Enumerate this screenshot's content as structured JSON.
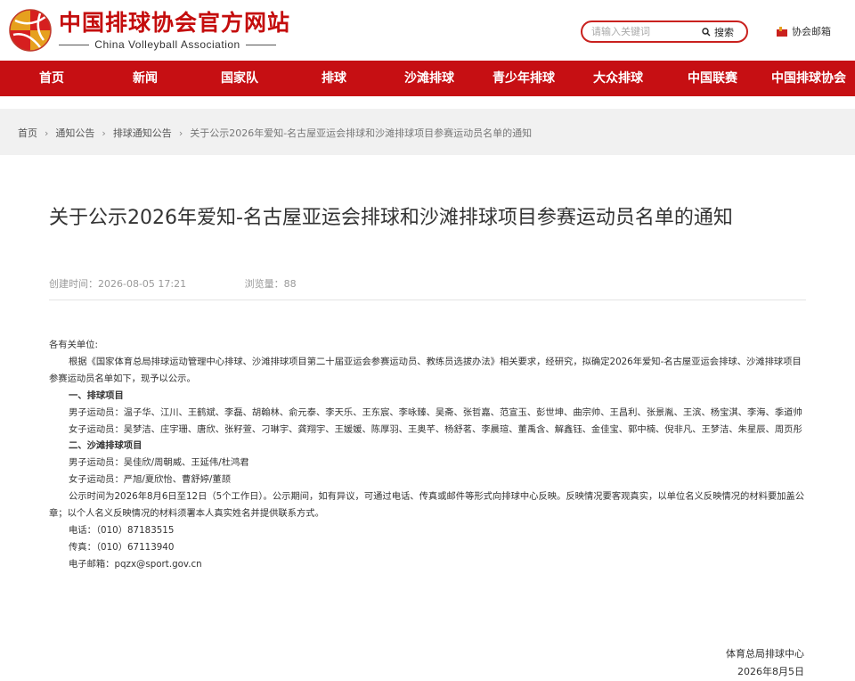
{
  "header": {
    "site_title": "中国排球协会官方网站",
    "site_subtitle": "China Volleyball Association",
    "search_placeholder": "请输入关键词",
    "search_button": "搜索",
    "mail_link": "协会邮箱"
  },
  "colors": {
    "brand_red": "#c60f13",
    "logo_gold": "#e6a01e",
    "logo_red": "#d61f1f"
  },
  "nav": {
    "items": [
      {
        "label": "首页"
      },
      {
        "label": "新闻"
      },
      {
        "label": "国家队"
      },
      {
        "label": "排球"
      },
      {
        "label": "沙滩排球"
      },
      {
        "label": "青少年排球"
      },
      {
        "label": "大众排球"
      },
      {
        "label": "中国联赛"
      },
      {
        "label": "中国排球协会"
      }
    ]
  },
  "breadcrumb": {
    "items": [
      "首页",
      "通知公告",
      "排球通知公告",
      "关于公示2026年爱知-名古屋亚运会排球和沙滩排球项目参赛运动员名单的通知"
    ]
  },
  "article": {
    "title": "关于公示2026年爱知-名古屋亚运会排球和沙滩排球项目参赛运动员名单的通知",
    "created_label": "创建时间：",
    "created_value": "2026-08-05 17:21",
    "views_label": "浏览量：",
    "views_value": "88",
    "paragraphs": [
      "各有关单位:",
      "根据《国家体育总局排球运动管理中心排球、沙滩排球项目第二十届亚运会参赛运动员、教练员选拔办法》相关要求，经研究，拟确定2026年爱知-名古屋亚运会排球、沙滩排球项目参赛运动员名单如下，现予以公示。",
      "一、排球项目",
      "男子运动员：温子华、江川、王鹤斌、李磊、胡翰林、俞元泰、李天乐、王东宸、李咏臻、吴斋、张哲嘉、范宣玉、彭世坤、曲宗帅、王昌利、张景胤、王滨、杨宝淇、李海、季道帅",
      "女子运动员：吴梦洁、庄宇珊、唐欣、张籽萱、刁琳宇、龚翔宇、王媛媛、陈厚羽、王奥芊、杨舒茗、李晨瑄、董禹含、解鑫钰、金佳宝、郭中楠、倪非凡、王梦洁、朱星辰、周页彤",
      "二、沙滩排球项目",
      "男子运动员：吴佳欣/周朝威、王延伟/杜鸿君",
      "女子运动员：严旭/夏欣怡、曹舒婷/董颉",
      "公示时间为2026年8月6日至12日（5个工作日）。公示期间，如有异议，可通过电话、传真或邮件等形式向排球中心反映。反映情况要客观真实，以单位名义反映情况的材料要加盖公章；以个人名义反映情况的材料须署本人真实姓名并提供联系方式。",
      "电话：（010）87183515",
      "传真：（010）67113940",
      "电子邮箱：pqzx@sport.gov.cn"
    ],
    "signature_org": "体育总局排球中心",
    "signature_date": "2026年8月5日"
  }
}
